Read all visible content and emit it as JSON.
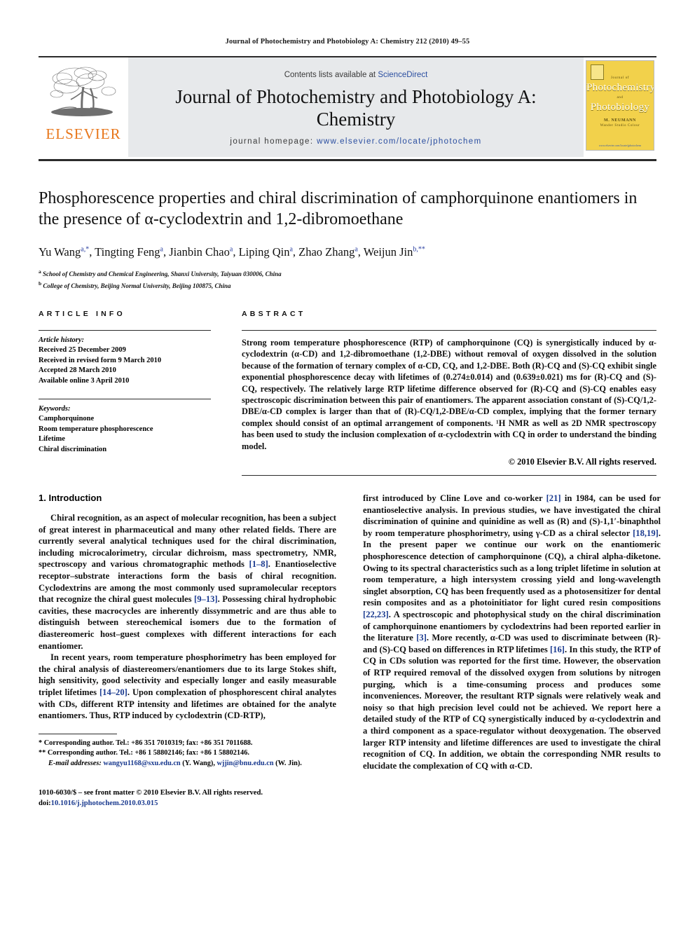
{
  "running_head": "Journal of Photochemistry and Photobiology A: Chemistry 212 (2010) 49–55",
  "masthead": {
    "publisher_name": "ELSEVIER",
    "contents_prefix": "Contents lists available at ",
    "contents_link": "ScienceDirect",
    "journal_title_line1": "Journal of Photochemistry and Photobiology A:",
    "journal_title_line2": "Chemistry",
    "homepage_prefix": "journal homepage: ",
    "homepage_url": "www.elsevier.com/locate/jphotochem",
    "cover": {
      "line_top": "Journal of",
      "line_big1": "Photochemistry",
      "line_and": "and",
      "line_big2": "Photobiology",
      "editors": "M. NEUMANN",
      "editors_sub": "Wander Studio Colour",
      "footer_url": "www.elsevier.com/locate/jphotochem"
    }
  },
  "article": {
    "title": "Phosphorescence properties and chiral discrimination of camphorquinone enantiomers in the presence of α-cyclodextrin and 1,2-dibromoethane",
    "authors_html": "Yu Wang<sup>a,*</sup>, Tingting Feng<sup>a</sup>, Jianbin Chao<sup>a</sup>, Liping Qin<sup>a</sup>, Zhao Zhang<sup>a</sup>, Weijun Jin<sup>b,**</sup>",
    "affiliation_a": "School of Chemistry and Chemical Engineering, Shanxi University, Taiyuan 030006, China",
    "affiliation_b": "College of Chemistry, Beijing Normal University, Beijing 100875, China"
  },
  "article_info": {
    "heading": "ARTICLE INFO",
    "history_label": "Article history:",
    "history": [
      "Received 25 December 2009",
      "Received in revised form 9 March 2010",
      "Accepted 28 March 2010",
      "Available online 3 April 2010"
    ],
    "keywords_label": "Keywords:",
    "keywords": [
      "Camphorquinone",
      "Room temperature phosphorescence",
      "Lifetime",
      "Chiral discrimination"
    ]
  },
  "abstract": {
    "heading": "ABSTRACT",
    "text": "Strong room temperature phosphorescence (RTP) of camphorquinone (CQ) is synergistically induced by α-cyclodextrin (α-CD) and 1,2-dibromoethane (1,2-DBE) without removal of oxygen dissolved in the solution because of the formation of ternary complex of α-CD, CQ, and 1,2-DBE. Both (R)-CQ and (S)-CQ exhibit single exponential phosphorescence decay with lifetimes of (0.274±0.014) and (0.639±0.021) ms for (R)-CQ and (S)-CQ, respectively. The relatively large RTP lifetime difference observed for (R)-CQ and (S)-CQ enables easy spectroscopic discrimination between this pair of enantiomers. The apparent association constant of (S)-CQ/1,2-DBE/α-CD complex is larger than that of (R)-CQ/1,2-DBE/α-CD complex, implying that the former ternary complex should consist of an optimal arrangement of components. ¹H NMR as well as 2D NMR spectroscopy has been used to study the inclusion complexation of α-cyclodextrin with CQ in order to understand the binding model.",
    "copyright": "© 2010 Elsevier B.V. All rights reserved."
  },
  "introduction": {
    "section_number_title": "1.  Introduction",
    "left_paragraphs": [
      "Chiral recognition, as an aspect of molecular recognition, has been a subject of great interest in pharmaceutical and many other related fields. There are currently several analytical techniques used for the chiral discrimination, including microcalorimetry, circular dichroism, mass spectrometry, NMR, spectroscopy and various chromatographic methods [1–8]. Enantioselective receptor–substrate interactions form the basis of chiral recognition. Cyclodextrins are among the most commonly used supramolecular receptors that recognize the chiral guest molecules [9–13]. Possessing chiral hydrophobic cavities, these macrocycles are inherently dissymmetric and are thus able to distinguish between stereochemical isomers due to the formation of diastereomeric host–guest complexes with different interactions for each enantiomer.",
      "In recent years, room temperature phosphorimetry has been employed for the chiral analysis of diastereomers/enantiomers due to its large Stokes shift, high sensitivity, good selectivity and especially longer and easily measurable triplet lifetimes [14–20]. Upon complexation of phosphorescent chiral analytes with CDs, different RTP intensity and lifetimes are obtained for the analyte enantiomers. Thus, RTP induced by cyclodextrin (CD-RTP),"
    ],
    "right_paragraphs": [
      "first introduced by Cline Love and co-worker [21] in 1984, can be used for enantioselective analysis. In previous studies, we have investigated the chiral discrimination of quinine and quinidine as well as (R) and (S)-1,1′-binaphthol by room temperature phosphorimetry, using γ-CD as a chiral selector [18,19]. In the present paper we continue our work on the enantiomeric phosphorescence detection of camphorquinone (CQ), a chiral alpha-diketone. Owing to its spectral characteristics such as a long triplet lifetime in solution at room temperature, a high intersystem crossing yield and long-wavelength singlet absorption, CQ has been frequently used as a photosensitizer for dental resin composites and as a photoinitiator for light cured resin compositions [22,23]. A spectroscopic and photophysical study on the chiral discrimination of camphorquinone enantiomers by cyclodextrins had been reported earlier in the literature [3]. More recently, α-CD was used to discriminate between (R)- and (S)-CQ based on differences in RTP lifetimes [16]. In this study, the RTP of CQ in CDs solution was reported for the first time. However, the observation of RTP required removal of the dissolved oxygen from solutions by nitrogen purging, which is a time-consuming process and produces some inconveniences. Moreover, the resultant RTP signals were relatively weak and noisy so that high precision level could not be achieved. We report here a detailed study of the RTP of CQ synergistically induced by α-cyclodextrin and a third component as a space-regulator without deoxygenation. The observed larger RTP intensity and lifetime differences are used to investigate the chiral recognition of CQ. In addition, we obtain the corresponding NMR results to elucidate the complexation of CQ with α-CD."
    ]
  },
  "footnotes": {
    "line1": "* Corresponding author. Tel.: +86 351 7010319; fax: +86 351 7011688.",
    "line2": "** Corresponding author. Tel.: +86 1 58802146; fax: +86 1 58802146.",
    "email_label": "E-mail addresses:",
    "email1": "wangyu1168@sxu.edu.cn",
    "email1_who": "(Y. Wang),",
    "email2": "wjjin@bnu.edu.cn",
    "email2_who": "(W. Jin)."
  },
  "footer": {
    "issn_line": "1010-6030/$ – see front matter © 2010 Elsevier B.V. All rights reserved.",
    "doi_label": "doi:",
    "doi_value": "10.1016/j.jphotochem.2010.03.015"
  }
}
